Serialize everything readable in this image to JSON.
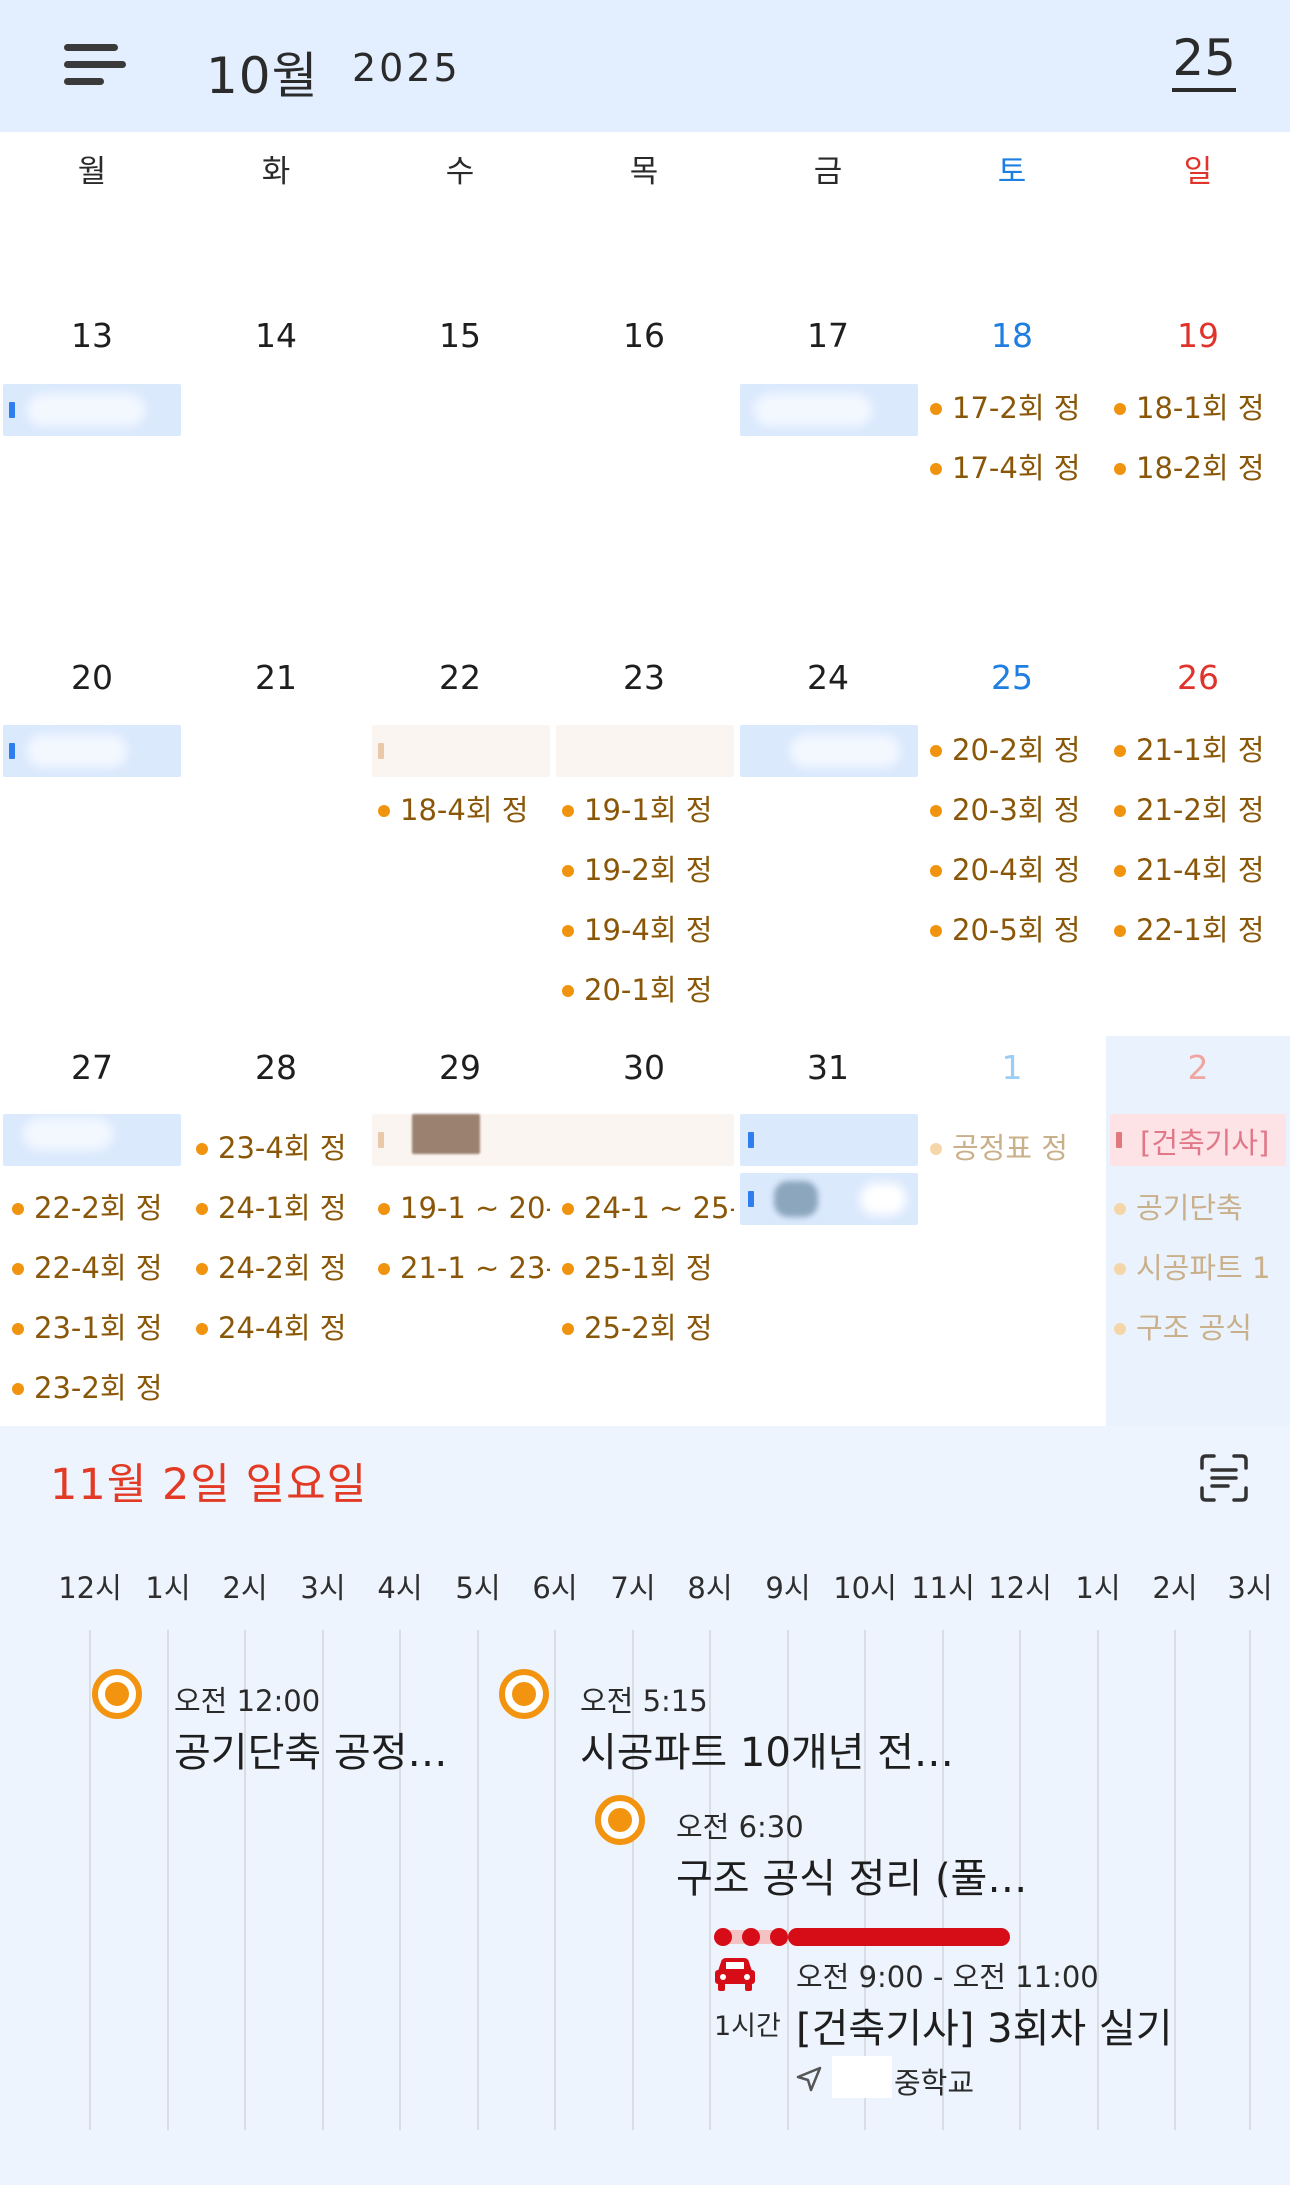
{
  "header": {
    "month": "10월",
    "year": "2025",
    "today": "25"
  },
  "weekdays": [
    "월",
    "화",
    "수",
    "목",
    "금",
    "토",
    "일"
  ],
  "weeks": [
    {
      "days": [
        "13",
        "14",
        "15",
        "16",
        "17",
        "18",
        "19"
      ]
    },
    {
      "days": [
        "20",
        "21",
        "22",
        "23",
        "24",
        "25",
        "26"
      ]
    },
    {
      "days": [
        "27",
        "28",
        "29",
        "30",
        "31",
        "1",
        "2"
      ]
    }
  ],
  "events": {
    "d18": [
      "17-2회 정",
      "17-4회 정"
    ],
    "d19": [
      "18-1회 정",
      "18-2회 정"
    ],
    "d22": [
      "18-4회 정"
    ],
    "d23": [
      "19-1회 정",
      "19-2회 정",
      "19-4회 정",
      "20-1회 정"
    ],
    "d25": [
      "20-2회 정",
      "20-3회 정",
      "20-4회 정",
      "20-5회 정"
    ],
    "d26": [
      "21-1회 정",
      "21-2회 정",
      "21-4회 정",
      "22-1회 정"
    ],
    "d27": [
      "22-2회 정",
      "22-4회 정",
      "23-1회 정",
      "23-2회 정"
    ],
    "d28": [
      "23-4회 정",
      "24-1회 정",
      "24-2회 정",
      "24-4회 정"
    ],
    "d29": [
      "19-1 ~ 20-",
      "21-1 ~ 23-"
    ],
    "d30": [
      "24-1 ~ 25-",
      "25-1회 정",
      "25-2회 정"
    ],
    "d1": [
      "공정표 정"
    ],
    "d2_bar": "[건축기사]",
    "d2": [
      "공기단축",
      "시공파트 1",
      "구조 공식"
    ]
  },
  "agenda": {
    "date": "11월 2일 일요일",
    "hours": [
      "12시",
      "1시",
      "2시",
      "3시",
      "4시",
      "5시",
      "6시",
      "7시",
      "8시",
      "9시",
      "10시",
      "11시",
      "12시",
      "1시",
      "2시",
      "3시"
    ],
    "items": [
      {
        "time": "오전 12:00",
        "title": "공기단축 공정…"
      },
      {
        "time": "오전 5:15",
        "title": "시공파트 10개년 전…"
      },
      {
        "time": "오전 6:30",
        "title": "구조 공식 정리 (풀…"
      },
      {
        "time": "오전 9:00 - 오전 11:00",
        "title": "[건축기사] 3회차 실기",
        "travel": "1시간",
        "location": "중학교"
      }
    ]
  },
  "colors": {
    "header_bg": "#e3effe",
    "saturday": "#1f7fe0",
    "sunday": "#e0332b",
    "event_dot": "#f0940f",
    "event_text": "#8a5708",
    "travel_red": "#d60c16",
    "selected_date": "#e33a25"
  },
  "icons": {
    "menu": "menu-icon",
    "scan": "scan-text-icon",
    "car": "car-icon",
    "location": "navigation-arrow-icon",
    "event": "event-circle-icon"
  }
}
